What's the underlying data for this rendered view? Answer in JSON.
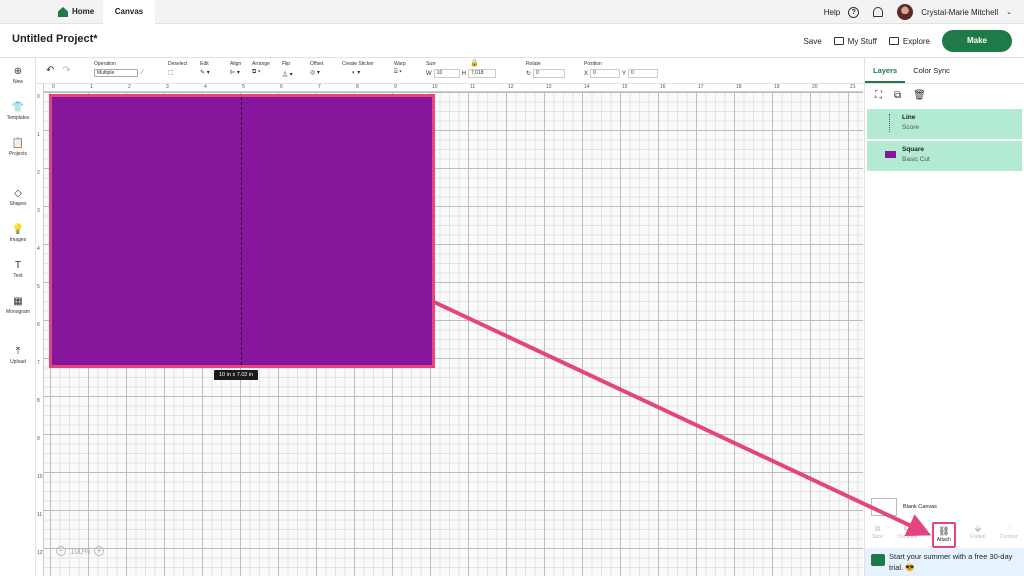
{
  "topbar": {
    "home_label": "Home",
    "canvas_label": "Canvas",
    "help_label": "Help",
    "user_name": "Crystal-Marie Mitchell"
  },
  "header": {
    "title": "Untitled Project*",
    "save_label": "Save",
    "mystuff_label": "My Stuff",
    "explore_label": "Explore",
    "make_label": "Make"
  },
  "leftnav": {
    "items": [
      {
        "label": "New",
        "icon": "plus-icon"
      },
      {
        "label": "Templates",
        "icon": "shirt-icon"
      },
      {
        "label": "Projects",
        "icon": "clipboard-icon"
      },
      {
        "label": "Shapes",
        "icon": "shapes-icon"
      },
      {
        "label": "Images",
        "icon": "bulb-icon"
      },
      {
        "label": "Text",
        "icon": "text-icon"
      },
      {
        "label": "Monogram",
        "icon": "monogram-icon"
      },
      {
        "label": "Upload",
        "icon": "upload-icon"
      }
    ]
  },
  "toolbar": {
    "operation_label": "Operation",
    "operation_value": "Multiple",
    "deselect_label": "Deselect",
    "edit_label": "Edit",
    "align_label": "Align",
    "arrange_label": "Arrange",
    "flip_label": "Flip",
    "offset_label": "Offset",
    "sticker_label": "Create Sticker",
    "warp_label": "Warp",
    "size_label": "Size",
    "w_label": "W",
    "w_value": "10",
    "h_label": "H",
    "h_value": "7.018",
    "rotate_label": "Rotate",
    "rotate_value": "0",
    "position_label": "Position",
    "x_label": "X",
    "x_value": "0",
    "y_label": "Y",
    "y_value": "0"
  },
  "canvas": {
    "ruler_top": [
      "0",
      "1",
      "2",
      "3",
      "4",
      "5",
      "6",
      "7",
      "8",
      "9",
      "10",
      "11",
      "12",
      "13",
      "14",
      "15",
      "16",
      "17",
      "18",
      "19",
      "20",
      "21"
    ],
    "ruler_left": [
      "0",
      "1",
      "2",
      "3",
      "4",
      "5",
      "6",
      "7",
      "8",
      "9",
      "10",
      "11",
      "12"
    ],
    "dimension_badge": "10  in x 7.02  in",
    "zoom_level": "100%",
    "shape_color": "#86179c",
    "highlight_color": "#e4447f"
  },
  "rightpanel": {
    "tab_layers": "Layers",
    "tab_colorsync": "Color Sync",
    "layers": [
      {
        "name": "Line",
        "sub": "Score"
      },
      {
        "name": "Square",
        "sub": "Basic Cut"
      }
    ],
    "blank_canvas_label": "Blank Canvas",
    "actions": [
      "Slice",
      "Combine",
      "Attach",
      "Flatten",
      "Contour"
    ],
    "promo_text": "Start your summer with a free 30-day trial. 😎"
  }
}
